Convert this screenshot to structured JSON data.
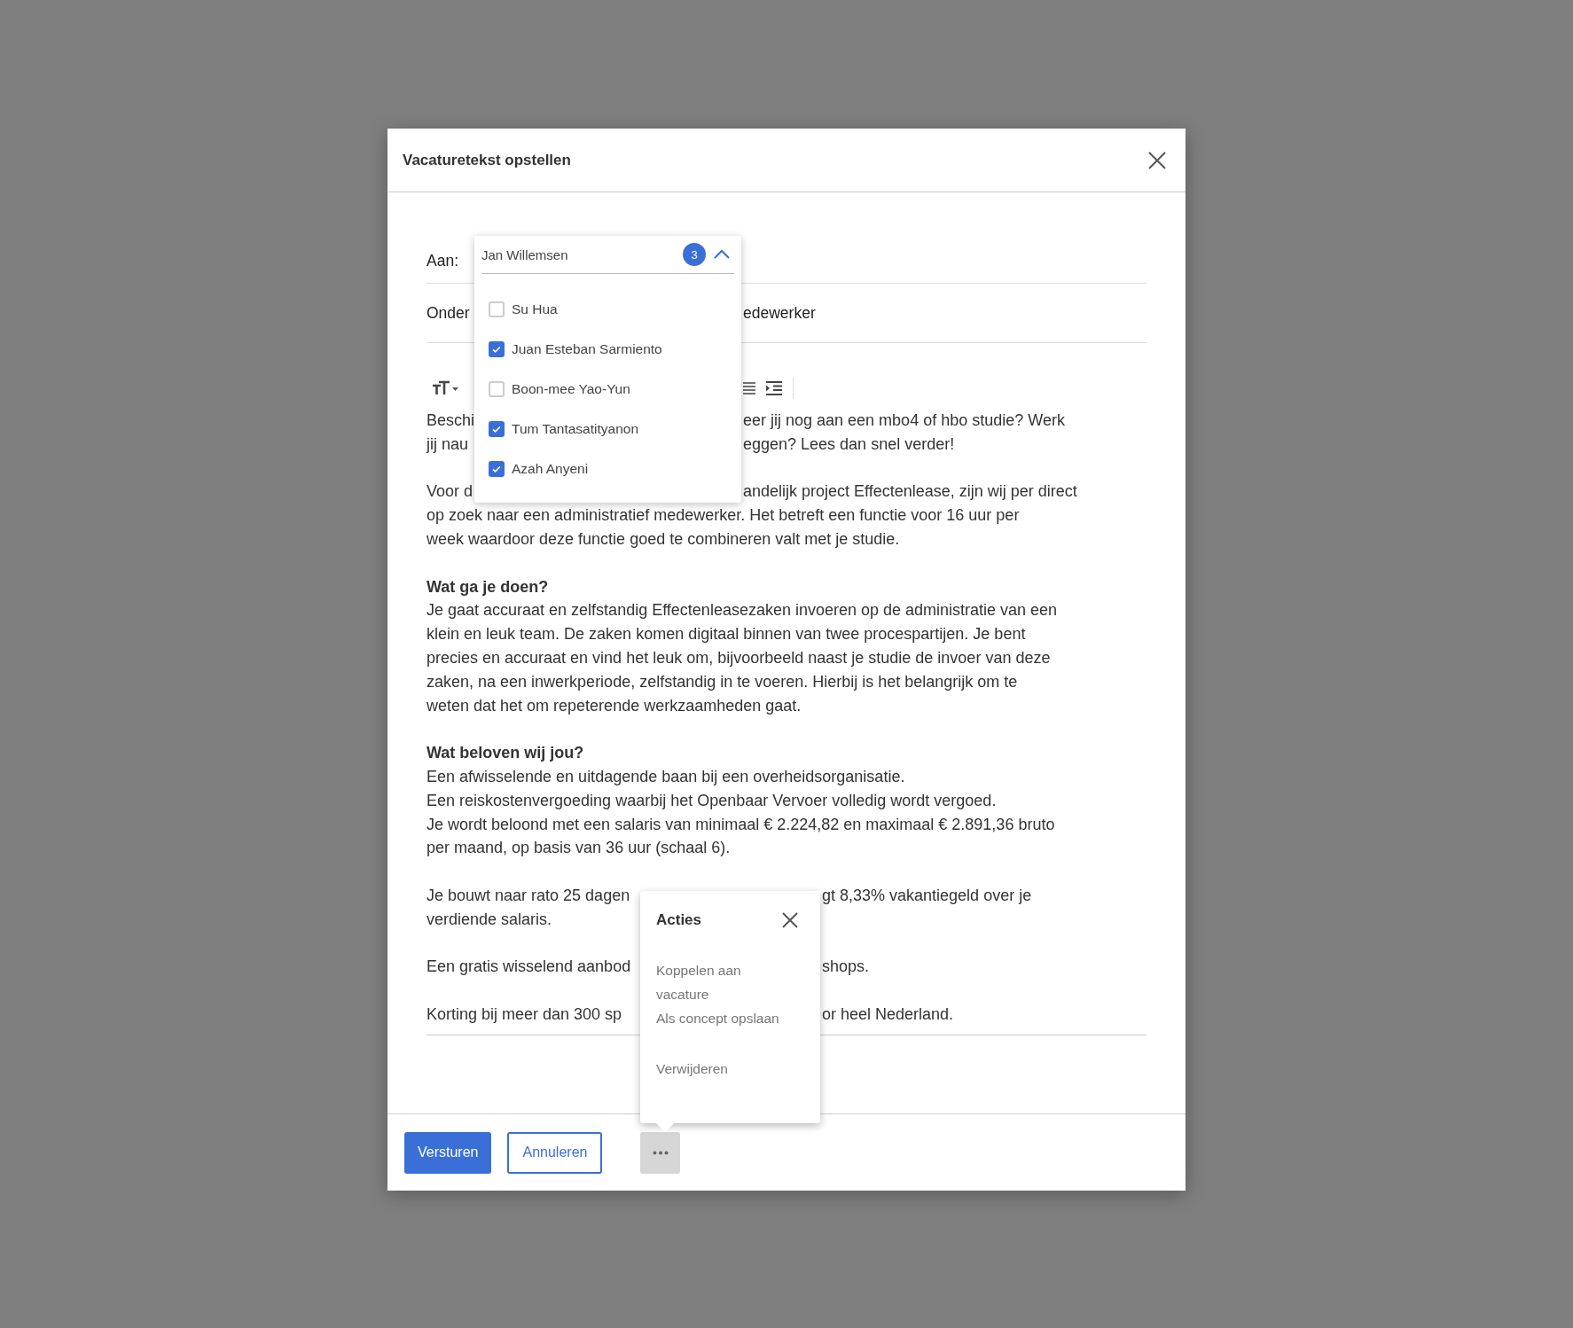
{
  "dialog": {
    "title": "Vacaturetekst opstellen"
  },
  "recipients": {
    "label": "Aan:",
    "value": "Jan Willemsen",
    "count": "3",
    "expanded": true,
    "options": [
      {
        "name": "Su Hua",
        "checked": false
      },
      {
        "name": "Juan Esteban Sarmiento",
        "checked": true
      },
      {
        "name": "Boon-mee Yao-Yun",
        "checked": false
      },
      {
        "name": "Tum Tantasatityanon",
        "checked": true
      },
      {
        "name": "Azah Anyeni",
        "checked": true
      }
    ]
  },
  "subject": {
    "label": "Onder",
    "value": "edewerker"
  },
  "body": {
    "paragraphs": [
      {
        "lines": [
          {
            "kind": "split",
            "parts": [
              "Beschi",
              "eer jij nog aan een mbo4 of hbo studie? Werk"
            ]
          },
          {
            "kind": "split",
            "parts": [
              "jij nau",
              "eggen? Lees dan snel verder!"
            ]
          }
        ]
      },
      {
        "lines": [
          {
            "kind": "split",
            "parts": [
              "Voor d",
              "andelijk project Effectenlease, zijn wij per direct"
            ]
          },
          {
            "kind": "line",
            "text": "op zoek naar een administratief medewerker. Het betreft een functie voor 16 uur per"
          },
          {
            "kind": "line",
            "text": "week waardoor deze functie goed te combineren valt met je studie."
          }
        ]
      },
      {
        "lines": [
          {
            "kind": "heading",
            "text": "Wat ga je doen?"
          },
          {
            "kind": "line",
            "text": "Je gaat accuraat en zelfstandig Effectenleasezaken invoeren op de administratie van een"
          },
          {
            "kind": "line",
            "text": "klein en leuk team. De zaken komen digitaal binnen van twee procespartijen. Je bent"
          },
          {
            "kind": "line",
            "text": "precies en accuraat en vind het leuk om, bijvoorbeeld naast je studie de invoer van deze"
          },
          {
            "kind": "line",
            "text": "zaken, na een inwerkperiode, zelfstandig in te voeren. Hierbij is het belangrijk om te"
          },
          {
            "kind": "line",
            "text": "weten dat het om repeterende werkzaamheden gaat."
          }
        ]
      },
      {
        "lines": [
          {
            "kind": "heading",
            "text": "Wat beloven wij jou?"
          },
          {
            "kind": "line",
            "text": "Een afwisselende en uitdagende baan bij een overheidsorganisatie."
          },
          {
            "kind": "line",
            "text": "Een reiskostenvergoeding waarbij het Openbaar Vervoer volledig wordt vergoed."
          },
          {
            "kind": "line",
            "text": "Je wordt beloond met een salaris van minimaal € 2.224,82 en maximaal € 2.891,36 bruto"
          },
          {
            "kind": "line",
            "text": "per maand, op basis van 36 uur (schaal 6)."
          }
        ]
      },
      {
        "lines": [
          {
            "kind": "split",
            "parts": [
              "Je bouwt naar rato 25 dagen",
              "gt 8,33% vakantiegeld over je"
            ]
          },
          {
            "kind": "line",
            "text": "verdiende salaris."
          }
        ]
      },
      {
        "lines": [
          {
            "kind": "split",
            "parts": [
              "Een gratis wisselend aanbod",
              "shops."
            ]
          }
        ]
      },
      {
        "lines": [
          {
            "kind": "split",
            "parts": [
              "Korting bij meer dan 300 sp",
              "or heel Nederland."
            ]
          }
        ]
      }
    ]
  },
  "actions_menu": {
    "title": "Acties",
    "items": [
      "Koppelen aan vacature",
      "Als concept opslaan",
      "Verwijderen"
    ]
  },
  "buttons": [
    {
      "label": "Versturen",
      "kind": "primary"
    },
    {
      "label": "Annuleren",
      "kind": "secondary"
    }
  ]
}
